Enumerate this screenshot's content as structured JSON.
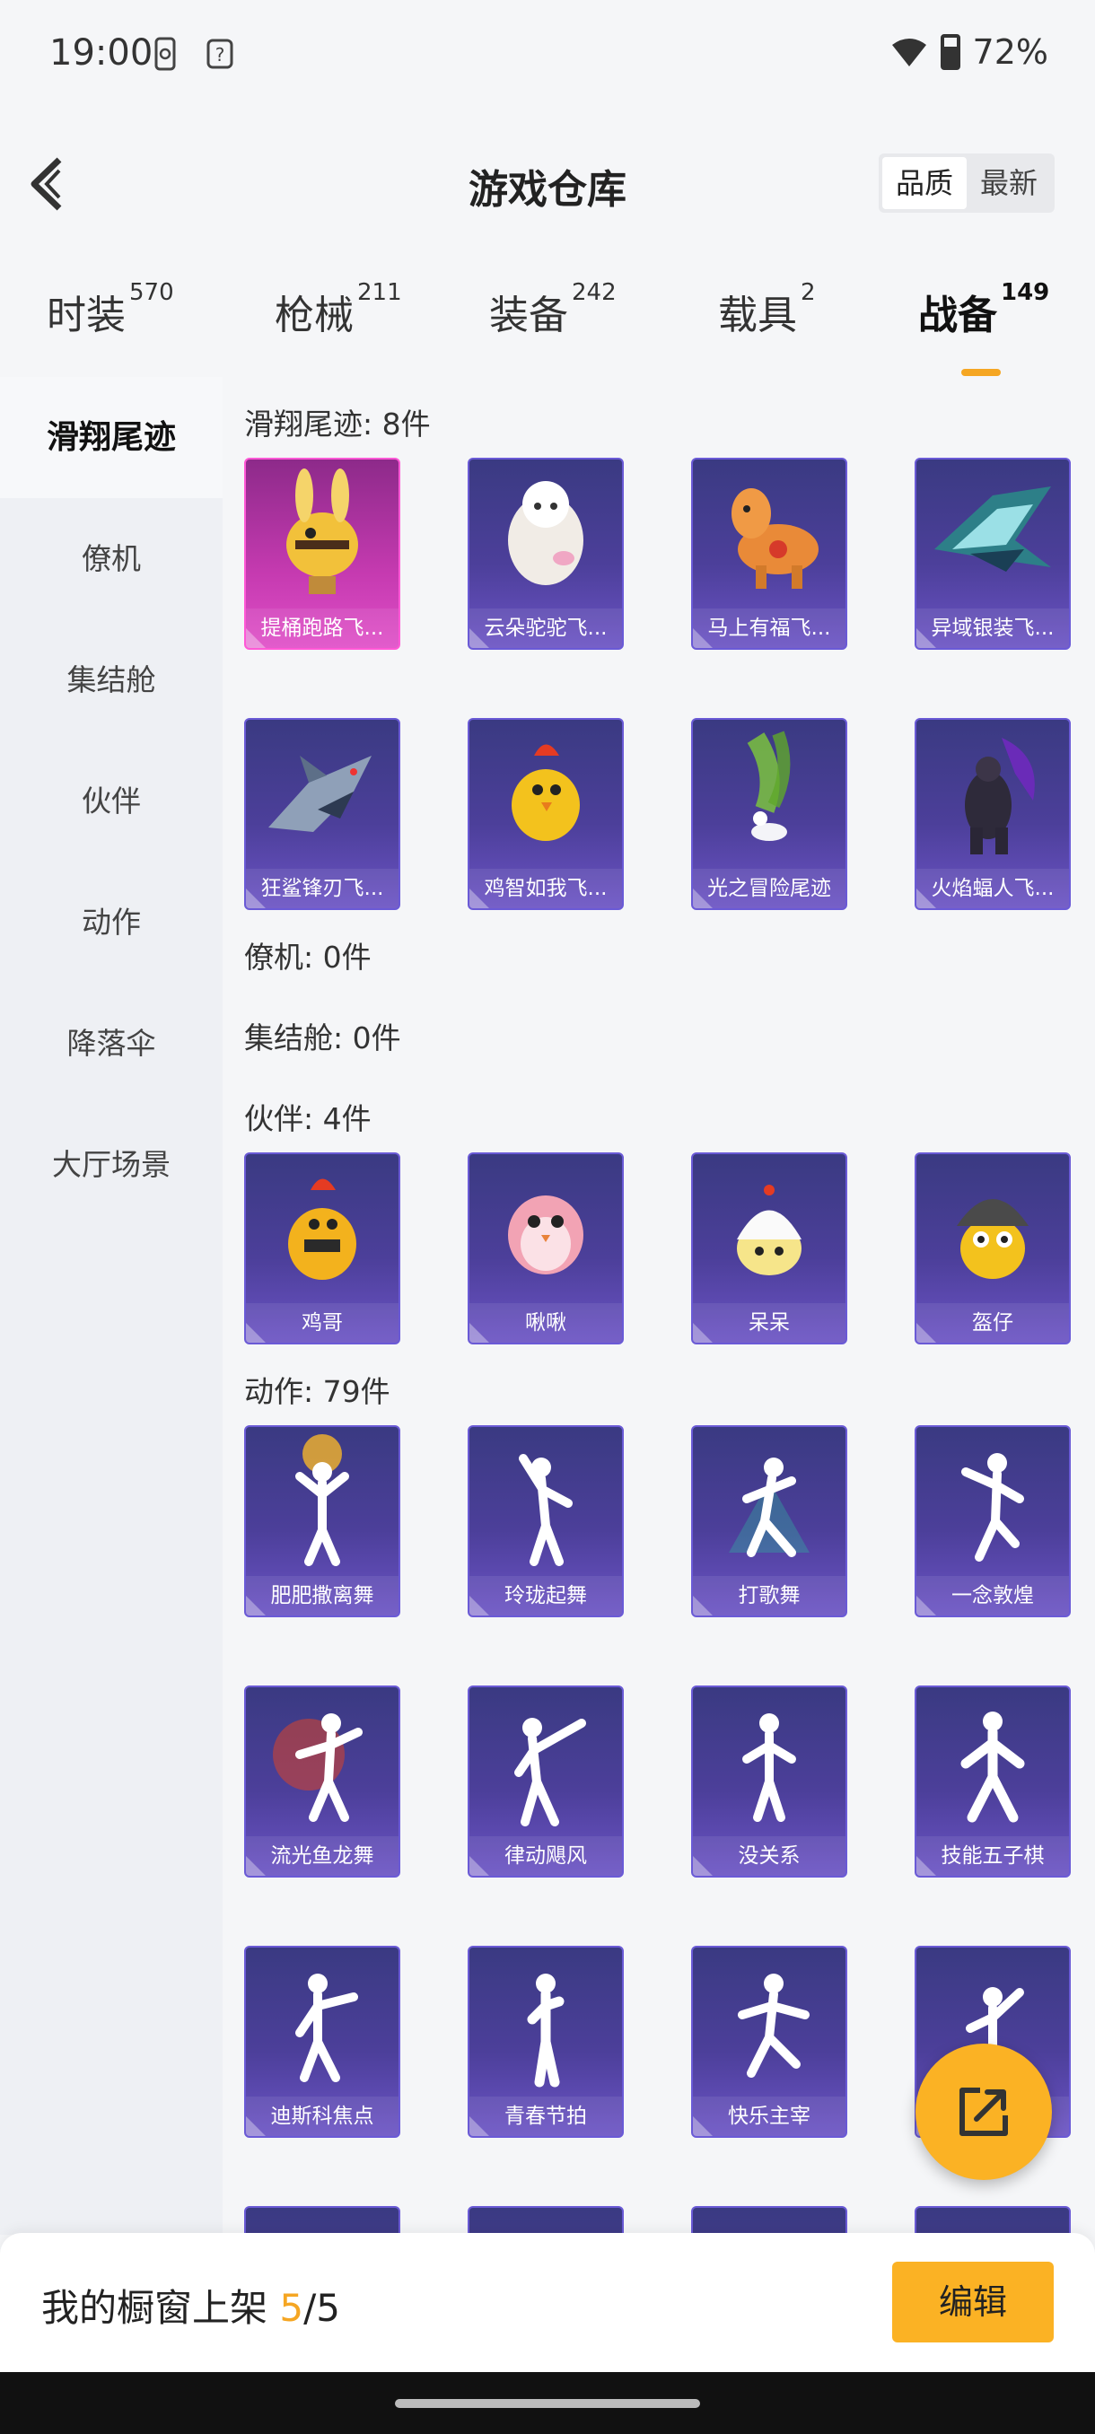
{
  "status_bar": {
    "time": "19:00",
    "battery": "72%"
  },
  "header": {
    "title": "游戏仓库",
    "sort_options": [
      "品质",
      "最新"
    ],
    "active_sort": "品质"
  },
  "tabs": [
    {
      "label": "时装",
      "count": "570"
    },
    {
      "label": "枪械",
      "count": "211"
    },
    {
      "label": "装备",
      "count": "242"
    },
    {
      "label": "载具",
      "count": "2"
    },
    {
      "label": "战备",
      "count": "149"
    }
  ],
  "sidebar": [
    "滑翔尾迹",
    "僚机",
    "集结舱",
    "伙伴",
    "动作",
    "降落伞",
    "大厅场景"
  ],
  "sections": {
    "glide": {
      "title": "滑翔尾迹: 8件",
      "items": [
        "提桶跑路飞...",
        "云朵驼驼飞...",
        "马上有福飞...",
        "异域银装飞...",
        "狂鲨锋刃飞...",
        "鸡智如我飞...",
        "光之冒险尾迹",
        "火焰蝠人飞..."
      ]
    },
    "drone": {
      "title": "僚机: 0件"
    },
    "pod": {
      "title": "集结舱: 0件"
    },
    "partner": {
      "title": "伙伴: 4件",
      "items": [
        "鸡哥",
        "啾啾",
        "呆呆",
        "盔仔"
      ]
    },
    "emote": {
      "title": "动作: 79件",
      "items": [
        "肥肥撒离舞",
        "玲珑起舞",
        "打歌舞",
        "一念敦煌",
        "流光鱼龙舞",
        "律动飓风",
        "没关系",
        "技能五子棋",
        "迪斯科焦点",
        "青春节拍",
        "快乐主宰",
        ""
      ]
    }
  },
  "bottom": {
    "showcase_label": "我的橱窗上架",
    "showcase_current": "5",
    "showcase_sep": "/",
    "showcase_total": "5",
    "edit_label": "编辑"
  },
  "colors": {
    "accent": "#fbb224",
    "card": "#4c3f9a",
    "card_highlight": "#c53ab0"
  }
}
